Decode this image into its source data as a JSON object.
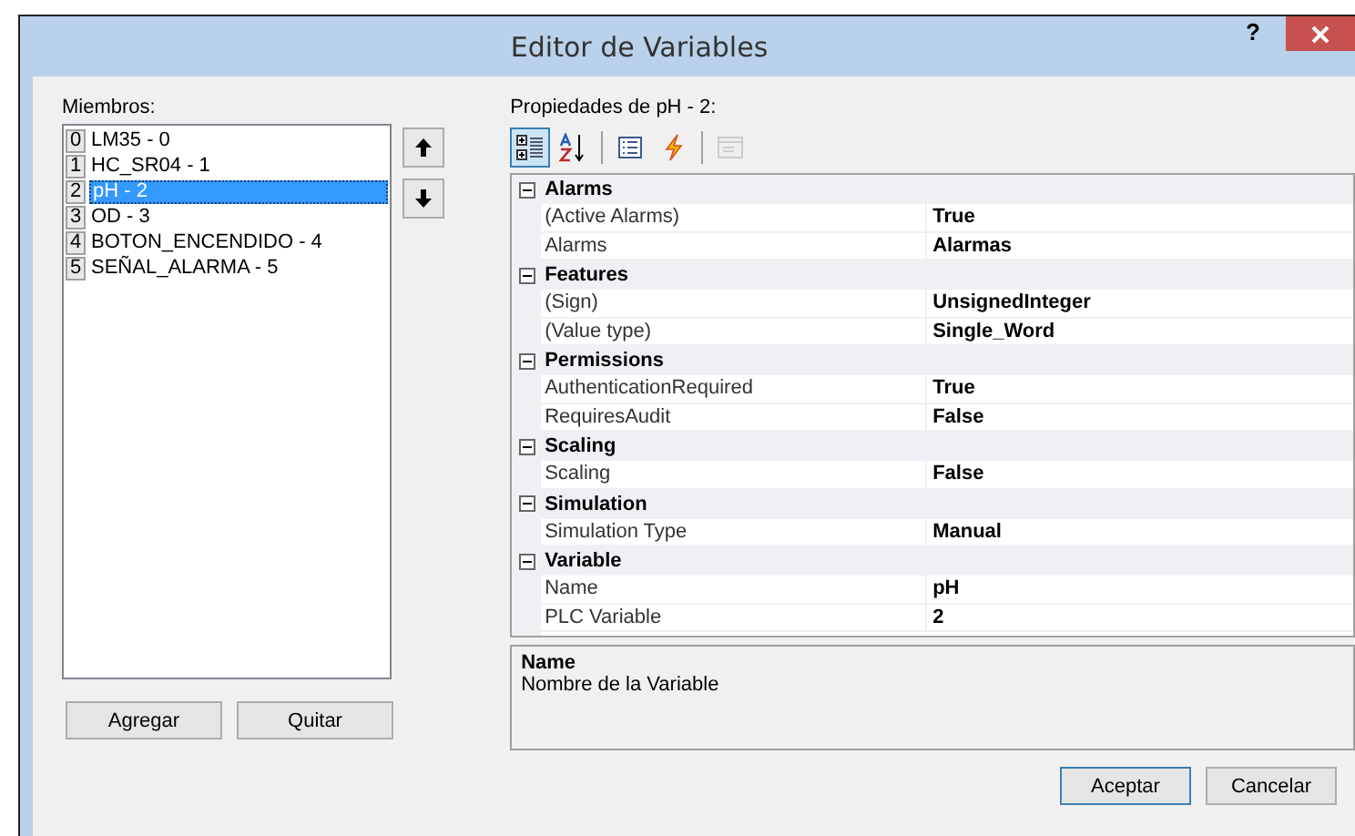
{
  "window": {
    "title": "Editor de Variables",
    "help": "?"
  },
  "members": {
    "label": "Miembros:",
    "items": [
      {
        "index": "0",
        "name": "LM35 - 0",
        "selected": false
      },
      {
        "index": "1",
        "name": "HC_SR04 - 1",
        "selected": false
      },
      {
        "index": "2",
        "name": "pH - 2",
        "selected": true
      },
      {
        "index": "3",
        "name": "OD - 3",
        "selected": false
      },
      {
        "index": "4",
        "name": "BOTON_ENCENDIDO - 4",
        "selected": false
      },
      {
        "index": "5",
        "name": "SEÑAL_ALARMA - 5",
        "selected": false
      }
    ]
  },
  "move_buttons": [
    {
      "kind": "up"
    },
    {
      "kind": "down"
    }
  ],
  "list_buttons": [
    "Agregar",
    "Quitar"
  ],
  "properties": {
    "label": "Propiedades de pH - 2:",
    "toolbar": [
      {
        "kind": "categorized",
        "selected": true,
        "disabled": false
      },
      {
        "kind": "alphabetical",
        "selected": false,
        "disabled": false
      },
      {
        "kind": "separator"
      },
      {
        "kind": "properties",
        "selected": false,
        "disabled": false
      },
      {
        "kind": "events",
        "selected": false,
        "disabled": false
      },
      {
        "kind": "separator"
      },
      {
        "kind": "pages",
        "selected": false,
        "disabled": true
      }
    ],
    "categories": [
      {
        "name": "Alarms",
        "expanded": true,
        "rows": [
          {
            "name": "(Active Alarms)",
            "value": "True"
          },
          {
            "name": "Alarms",
            "value": "Alarmas"
          }
        ]
      },
      {
        "name": "Features",
        "expanded": true,
        "rows": [
          {
            "name": "(Sign)",
            "value": "UnsignedInteger"
          },
          {
            "name": "(Value type)",
            "value": "Single_Word"
          }
        ]
      },
      {
        "name": "Permissions",
        "expanded": true,
        "rows": [
          {
            "name": "AuthenticationRequired",
            "value": "True"
          },
          {
            "name": "RequiresAudit",
            "value": "False"
          }
        ]
      },
      {
        "name": "Scaling",
        "expanded": true,
        "rows": [
          {
            "name": "Scaling",
            "value": "False"
          }
        ]
      },
      {
        "name": "Simulation",
        "expanded": true,
        "rows": [
          {
            "name": "Simulation Type",
            "value": "Manual"
          }
        ]
      },
      {
        "name": "Variable",
        "expanded": true,
        "rows": [
          {
            "name": "Name",
            "value": "pH"
          },
          {
            "name": "PLC Variable",
            "value": "2"
          }
        ]
      }
    ],
    "help": {
      "title": "Name",
      "description": "Nombre de la Variable"
    }
  },
  "dialog_buttons": [
    {
      "label": "Aceptar",
      "default": true
    },
    {
      "label": "Cancelar",
      "default": false
    }
  ]
}
